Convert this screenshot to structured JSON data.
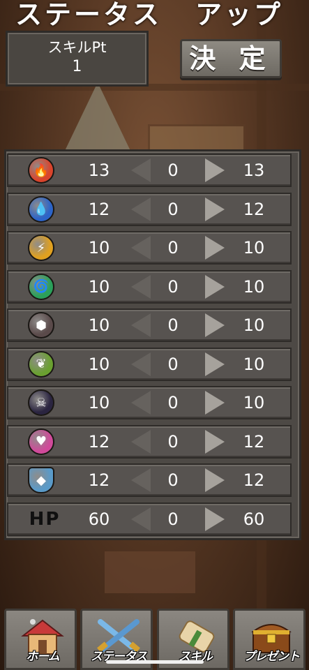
{
  "header": {
    "title_left": "ステータス",
    "title_right": "アップ"
  },
  "skill_points": {
    "label": "スキルPt",
    "value": "1"
  },
  "confirm_button": {
    "label": "決 定"
  },
  "stats": [
    {
      "icon": "fire-element-icon",
      "color": "#d9442c",
      "base": "13",
      "added": "0",
      "total": "13"
    },
    {
      "icon": "water-element-icon",
      "color": "#2c64c8",
      "base": "12",
      "added": "0",
      "total": "12"
    },
    {
      "icon": "lightning-element-icon",
      "color": "#e0a020",
      "base": "10",
      "added": "0",
      "total": "10"
    },
    {
      "icon": "wind-element-icon",
      "color": "#2aa05a",
      "base": "10",
      "added": "0",
      "total": "10"
    },
    {
      "icon": "earth-element-icon",
      "color": "#5a4a4a",
      "base": "10",
      "added": "0",
      "total": "10"
    },
    {
      "icon": "leaf-element-icon",
      "color": "#6aa030",
      "base": "10",
      "added": "0",
      "total": "10"
    },
    {
      "icon": "skull-dark-icon",
      "color": "#2a2440",
      "base": "10",
      "added": "0",
      "total": "10"
    },
    {
      "icon": "heart-charm-icon",
      "color": "#d04a9a",
      "base": "12",
      "added": "0",
      "total": "12"
    },
    {
      "icon": "shield-defense-icon",
      "color": "#5a9ac8",
      "base": "12",
      "added": "0",
      "total": "12"
    },
    {
      "icon": "hp-label",
      "label": "HP",
      "base": "60",
      "added": "0",
      "total": "60"
    }
  ],
  "nav": [
    {
      "id": "home",
      "label": "ホーム",
      "icon": "house-icon"
    },
    {
      "id": "status",
      "label": "ステータス",
      "icon": "crossed-swords-icon"
    },
    {
      "id": "skill",
      "label": "スキル",
      "icon": "scroll-icon"
    },
    {
      "id": "present",
      "label": "プレゼント",
      "icon": "treasure-chest-icon"
    }
  ]
}
